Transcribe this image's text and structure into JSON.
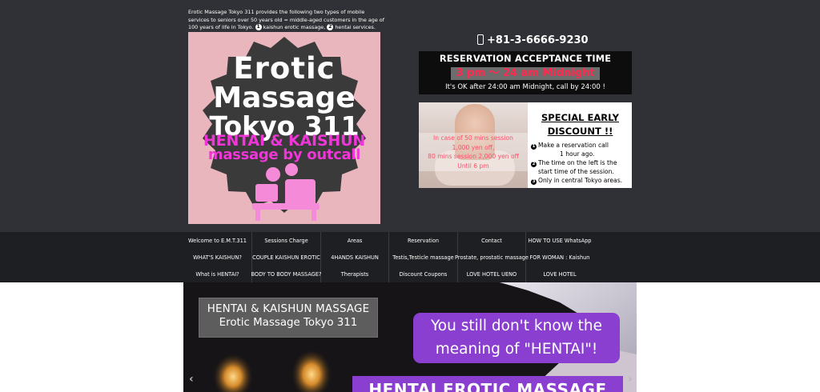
{
  "intro": {
    "text": "Erotic Massage Tokyo 311 provides the following two types of mobile services to seniors over 50 years old = middle-aged customers in the age of 100 years of life in Tokyo.",
    "n1": "1",
    "s1": "kaishun erotic massage,",
    "n2": "2",
    "s2": "hentai services."
  },
  "logo": {
    "line1": "Erotic",
    "line2": "Massage",
    "line3": "Tokyo 311",
    "line4": "HENTAI & KAISHUN",
    "line5": "massage by outcall",
    "colors": {
      "bg": "#eab6be",
      "badge": "#3a3a3a",
      "accent": "#f036d8"
    }
  },
  "phone": "+81-3-6666-9230",
  "reservation": {
    "title": "RESERVATION ACCEPTANCE TIME",
    "time": "3 pm ～ 24 am Midnight",
    "note": "It's OK after 24:00 am Midnight, call by 24:00 !"
  },
  "discount": {
    "overlay": [
      "In case of 50 mins session",
      "1,000 yen off,",
      "80 mins session 2,000 yen off",
      "Until 6 pm"
    ],
    "title1": "SPECIAL EARLY",
    "title2": "DISCOUNT !!",
    "items": [
      {
        "n": "1",
        "text": "Make a reservation call",
        "cont": "1 hour ago."
      },
      {
        "n": "2",
        "text": "The time on the left is the",
        "cont": "start time of the session."
      },
      {
        "n": "3",
        "text": "Only in central Tokyo areas."
      }
    ]
  },
  "nav": {
    "items": [
      "Welcome to E.M.T.311",
      "Sessions Charge",
      "Areas",
      "Reservation",
      "Contact",
      "HOW TO USE WhatsApp",
      "WHAT'S KAISHUN?",
      "COUPLE KAISHUN EROTIC",
      "4HANDS KAISHUN",
      "Testis,Testicle massage",
      "Prostate, prostatic massage",
      "FOR WOMAN : Kaishun",
      "What is HENTAI?",
      "BODY TO BODY MASSAGE?",
      "Therapists",
      "Discount Coupons",
      "LOVE HOTEL UENO",
      "LOVE HOTEL"
    ]
  },
  "hero": {
    "box_line1": "HENTAI & KAISHUN MASSAGE",
    "box_line2": "Erotic Massage Tokyo 311",
    "bubble_line1": "You still don't know the",
    "bubble_line2": "meaning of \"HENTAI\"!",
    "bottom": "HENTAI EROTIC MASSAGE",
    "prev": "‹",
    "next": "›"
  }
}
